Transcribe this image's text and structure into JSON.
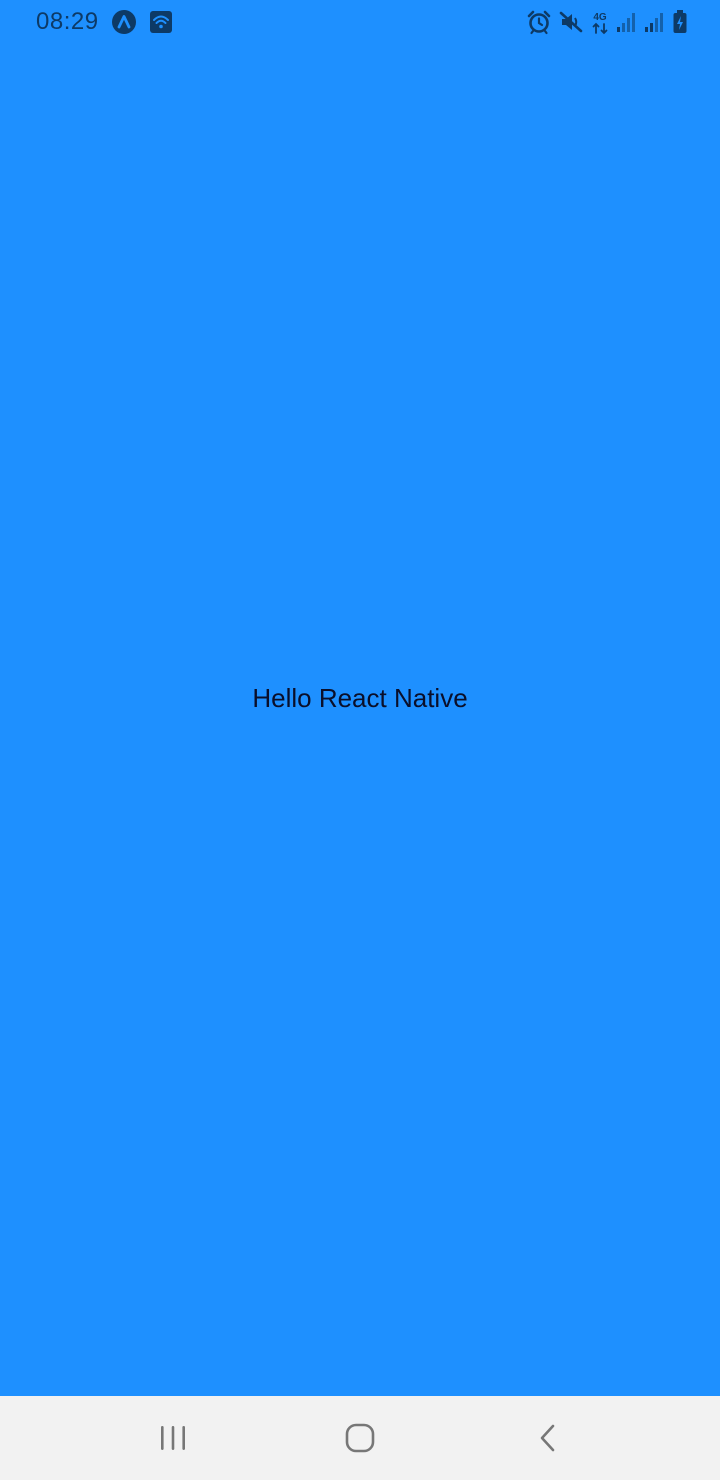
{
  "status_bar": {
    "time": "08:29",
    "network_label": "4G",
    "icons": {
      "left": [
        "app-notification-icon",
        "wifi-hotspot-icon"
      ],
      "right": [
        "alarm-icon",
        "mute-icon",
        "network-4g-icon",
        "signal-icon",
        "signal-icon",
        "battery-charging-icon"
      ]
    },
    "icon_color": "#0d3a66"
  },
  "main": {
    "greeting": "Hello React Native",
    "background_color": "#1e90ff",
    "text_color": "#0a0f2a"
  },
  "nav_bar": {
    "background_color": "#f2f2f2",
    "icon_color": "#777777",
    "buttons": [
      "recents-icon",
      "home-icon",
      "back-icon"
    ]
  }
}
